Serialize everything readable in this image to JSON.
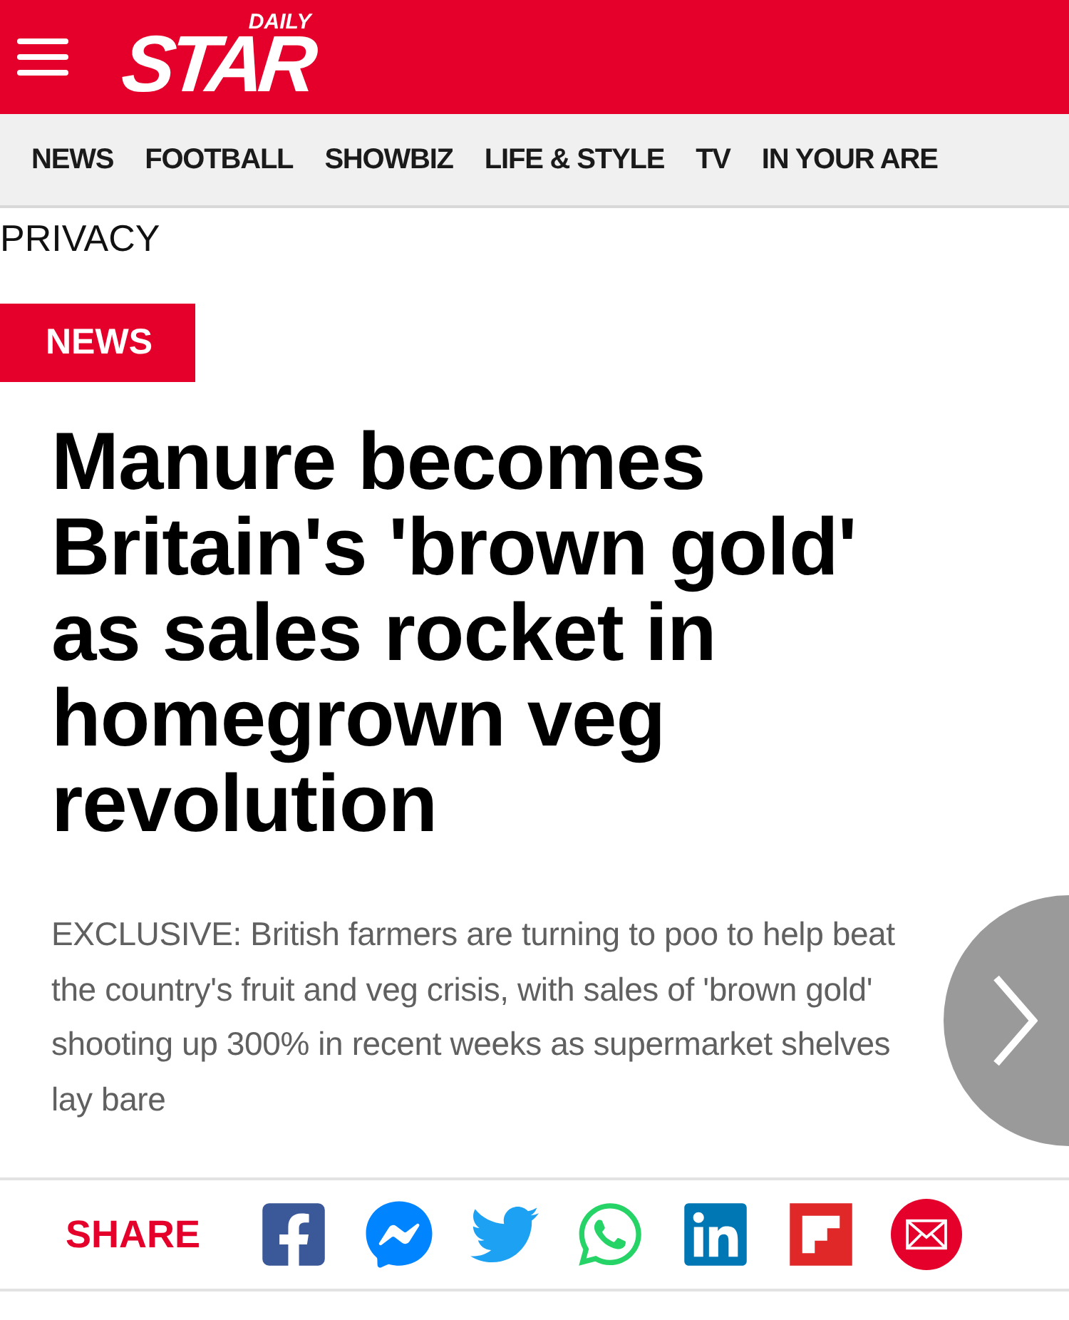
{
  "header": {
    "logo_top": "DAILY",
    "logo_main": "STAR"
  },
  "nav": [
    "NEWS",
    "FOOTBALL",
    "SHOWBIZ",
    "LIFE & STYLE",
    "TV",
    "IN YOUR ARE"
  ],
  "privacy_link": "PRIVACY",
  "section_badge": "NEWS",
  "headline": "Manure becomes Britain's 'brown gold' as sales rocket in homegrown veg revolution",
  "standfirst": "EXCLUSIVE: British farmers are turning to poo to help beat the country's fruit and veg crisis, with sales of 'brown gold' shooting up 300% in recent weeks as supermarket shelves lay bare",
  "share": {
    "label": "SHARE",
    "services": [
      {
        "kind": "facebook"
      },
      {
        "kind": "messenger"
      },
      {
        "kind": "twitter"
      },
      {
        "kind": "whatsapp"
      },
      {
        "kind": "linkedin"
      },
      {
        "kind": "flipboard"
      },
      {
        "kind": "email"
      }
    ]
  }
}
